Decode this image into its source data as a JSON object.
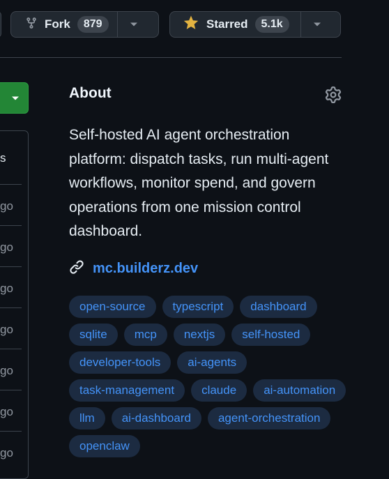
{
  "header": {
    "fork": {
      "label": "Fork",
      "count": "879"
    },
    "star": {
      "label": "Starred",
      "count": "5.1k"
    }
  },
  "left_partial": {
    "header_cell": "s",
    "rows": [
      "go",
      "go",
      "go",
      "go",
      "go",
      "go",
      "go"
    ]
  },
  "about": {
    "title": "About",
    "description": "Self-hosted AI agent orchestration platform: dispatch tasks, run multi-agent workflows, monitor spend, and govern operations from one mission control dashboard.",
    "link": "mc.builderz.dev",
    "topics": [
      "open-source",
      "typescript",
      "dashboard",
      "sqlite",
      "mcp",
      "nextjs",
      "self-hosted",
      "developer-tools",
      "ai-agents",
      "task-management",
      "claude",
      "ai-automation",
      "llm",
      "ai-dashboard",
      "agent-orchestration",
      "openclaw"
    ]
  },
  "colors": {
    "accent": "#4493f8",
    "star": "#e3b341",
    "green": "#238636",
    "background": "#0d1117"
  }
}
